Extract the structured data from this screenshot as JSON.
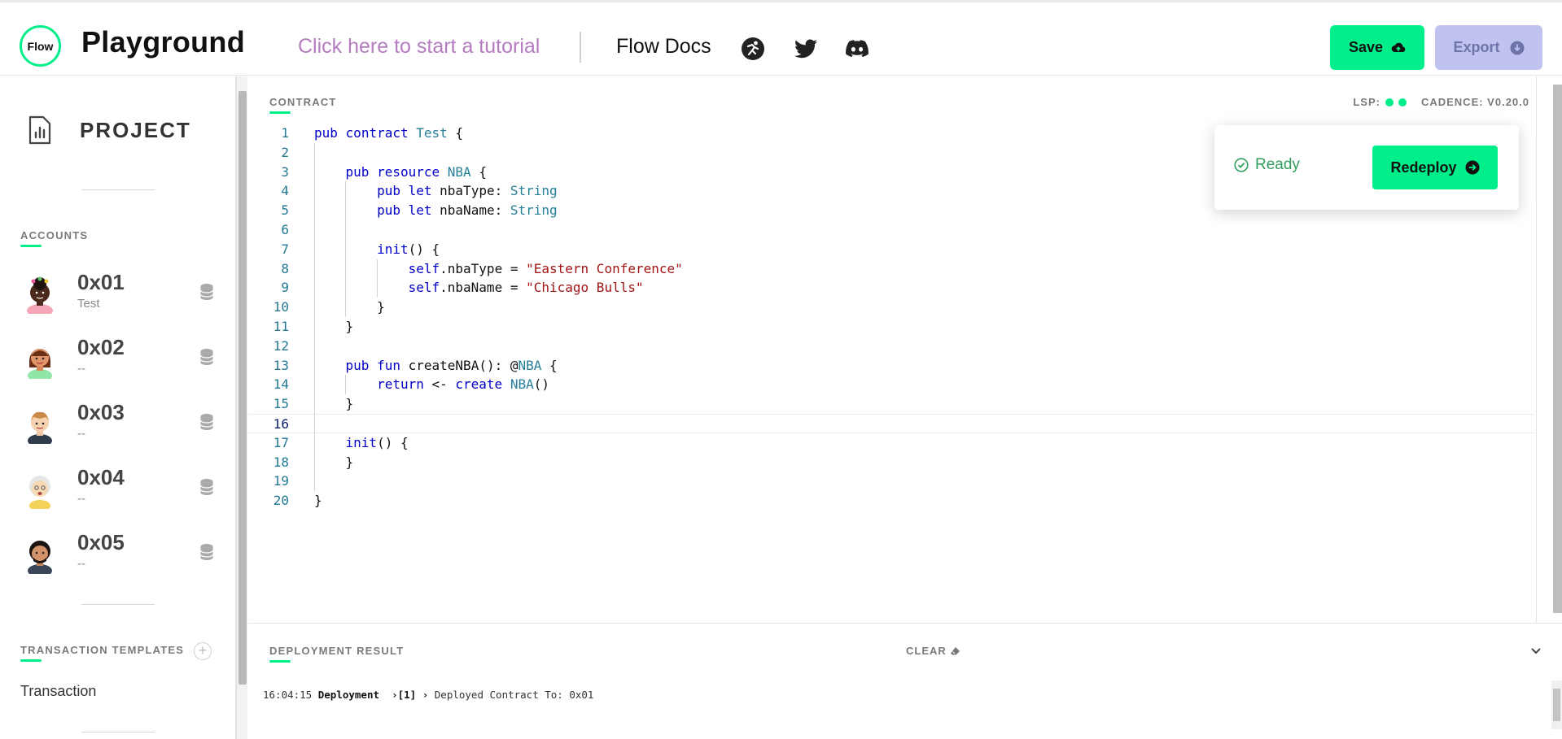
{
  "header": {
    "logo_text": "Flow",
    "app_title": "Playground",
    "tutorial_link": "Click here to start a tutorial",
    "docs_link": "Flow Docs",
    "save_label": "Save",
    "export_label": "Export",
    "social_icons": [
      "runner-icon",
      "twitter-icon",
      "discord-icon"
    ]
  },
  "sidebar": {
    "project_label": "PROJECT",
    "accounts_heading": "ACCOUNTS",
    "accounts": [
      {
        "address": "0x01",
        "sub": "Test"
      },
      {
        "address": "0x02",
        "sub": "--"
      },
      {
        "address": "0x03",
        "sub": "--"
      },
      {
        "address": "0x04",
        "sub": "--"
      },
      {
        "address": "0x05",
        "sub": "--"
      }
    ],
    "transaction_templates_heading": "TRANSACTION TEMPLATES",
    "transaction_item": "Transaction"
  },
  "editor": {
    "tab_label": "CONTRACT",
    "lsp_label": "LSP:",
    "cadence_label": "CADENCE: V0.20.0",
    "current_line": 16,
    "lines": [
      "pub contract Test {",
      "",
      "    pub resource NBA {",
      "        pub let nbaType: String",
      "        pub let nbaName: String",
      "",
      "        init() {",
      "            self.nbaType = \"Eastern Conference\"",
      "            self.nbaName = \"Chicago Bulls\"",
      "        }",
      "    }",
      "",
      "    pub fun createNBA(): @NBA {",
      "        return <- create NBA()",
      "    }",
      "",
      "    init() {",
      "    }",
      "",
      "}"
    ]
  },
  "popup": {
    "status": "Ready",
    "redeploy_label": "Redeploy"
  },
  "deployment": {
    "title": "DEPLOYMENT RESULT",
    "clear_label": "CLEAR",
    "log": {
      "time": "16:04:15",
      "kind": "Deployment",
      "index": "[1]",
      "message": "Deployed Contract To: 0x01"
    }
  },
  "colors": {
    "accent": "#00ef8b",
    "export_bg": "#c0c3ef",
    "tutorial_link": "#b57cc0",
    "ready_text": "#2f9e5c"
  }
}
